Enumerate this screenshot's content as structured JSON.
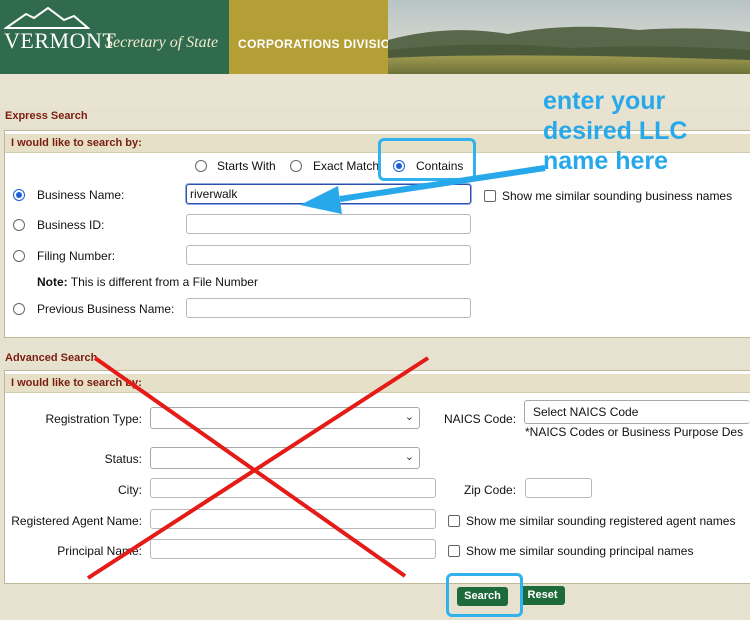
{
  "banner": {
    "logo": "VERMONT",
    "secretary": "Secretary of State",
    "division": "CORPORATIONS DIVISION"
  },
  "express": {
    "title": "Express Search",
    "subhead": "I would like to search by:",
    "match_options": [
      "Starts With",
      "Exact Match",
      "Contains"
    ],
    "business_name_label": "Business Name:",
    "business_name_value": "riverwalk",
    "similar_label": "Show me similar sounding business names",
    "business_id_label": "Business ID:",
    "filing_number_label": "Filing Number:",
    "note_bold": "Note:",
    "note_text": " This is different from a File Number",
    "previous_name_label": "Previous Business Name:"
  },
  "advanced": {
    "title": "Advanced Search",
    "subhead": "I would like to search by:",
    "registration_type_label": "Registration Type:",
    "naics_label": "NAICS Code:",
    "naics_value": "Select NAICS Code",
    "naics_note": "*NAICS Codes or Business Purpose Des",
    "status_label": "Status:",
    "city_label": "City:",
    "zip_label": "Zip Code:",
    "agent_label": "Registered Agent Name:",
    "agent_similar": "Show me similar sounding registered agent names",
    "principal_label": "Principal Name:",
    "principal_similar": "Show me similar sounding principal names"
  },
  "buttons": {
    "search": "Search",
    "reset": "Reset"
  },
  "annotation": {
    "line1": "enter your",
    "line2": "desired LLC",
    "line3": "name here"
  },
  "colors": {
    "annotation_blue": "#27a8ea",
    "button_green": "#1f6a3a",
    "section_title": "#7a1d10",
    "cross_red": "#e41b17"
  }
}
